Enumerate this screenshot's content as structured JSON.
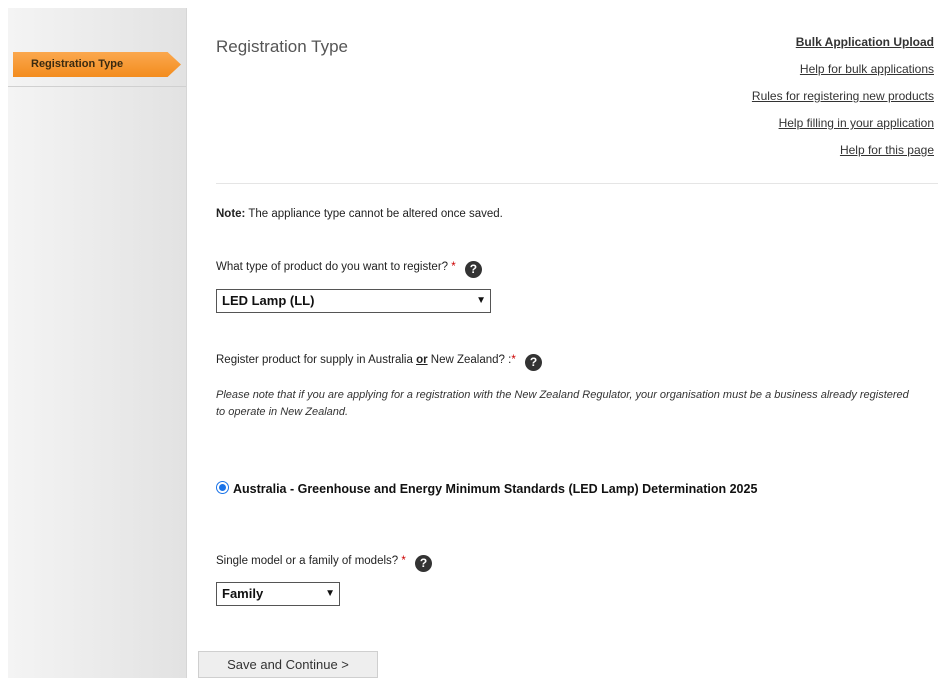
{
  "sidebar": {
    "active_item": "Registration Type"
  },
  "header": {
    "title": "Registration Type",
    "links": {
      "bulk_upload": "Bulk Application Upload",
      "help_bulk": "Help for bulk applications",
      "rules": "Rules for registering new products",
      "help_filling": "Help filling in your application",
      "help_page": "Help for this page"
    }
  },
  "note": {
    "label": "Note:",
    "text": " The appliance type cannot be altered once saved."
  },
  "product_type": {
    "question": "What type of product do you want to register?",
    "required_mark": "*",
    "help_icon": "?",
    "selected": "LED Lamp (LL)"
  },
  "region": {
    "question_pre": "Register product for supply in Australia ",
    "question_or": "or",
    "question_post": " New Zealand? :",
    "required_mark": "*",
    "help_icon": "?",
    "note": "Please note that if you are applying for a registration with the New Zealand Regulator, your organisation must be a business already registered to operate in New Zealand.",
    "option": "Australia - Greenhouse and Energy Minimum Standards (LED Lamp) Determination 2025"
  },
  "model": {
    "question": "Single model or a family of models?",
    "required_mark": "*",
    "help_icon": "?",
    "selected": "Family"
  },
  "actions": {
    "save_continue": "Save and Continue >"
  },
  "icons": {
    "help": "question-circle-icon",
    "caret": "chevron-down-icon"
  }
}
